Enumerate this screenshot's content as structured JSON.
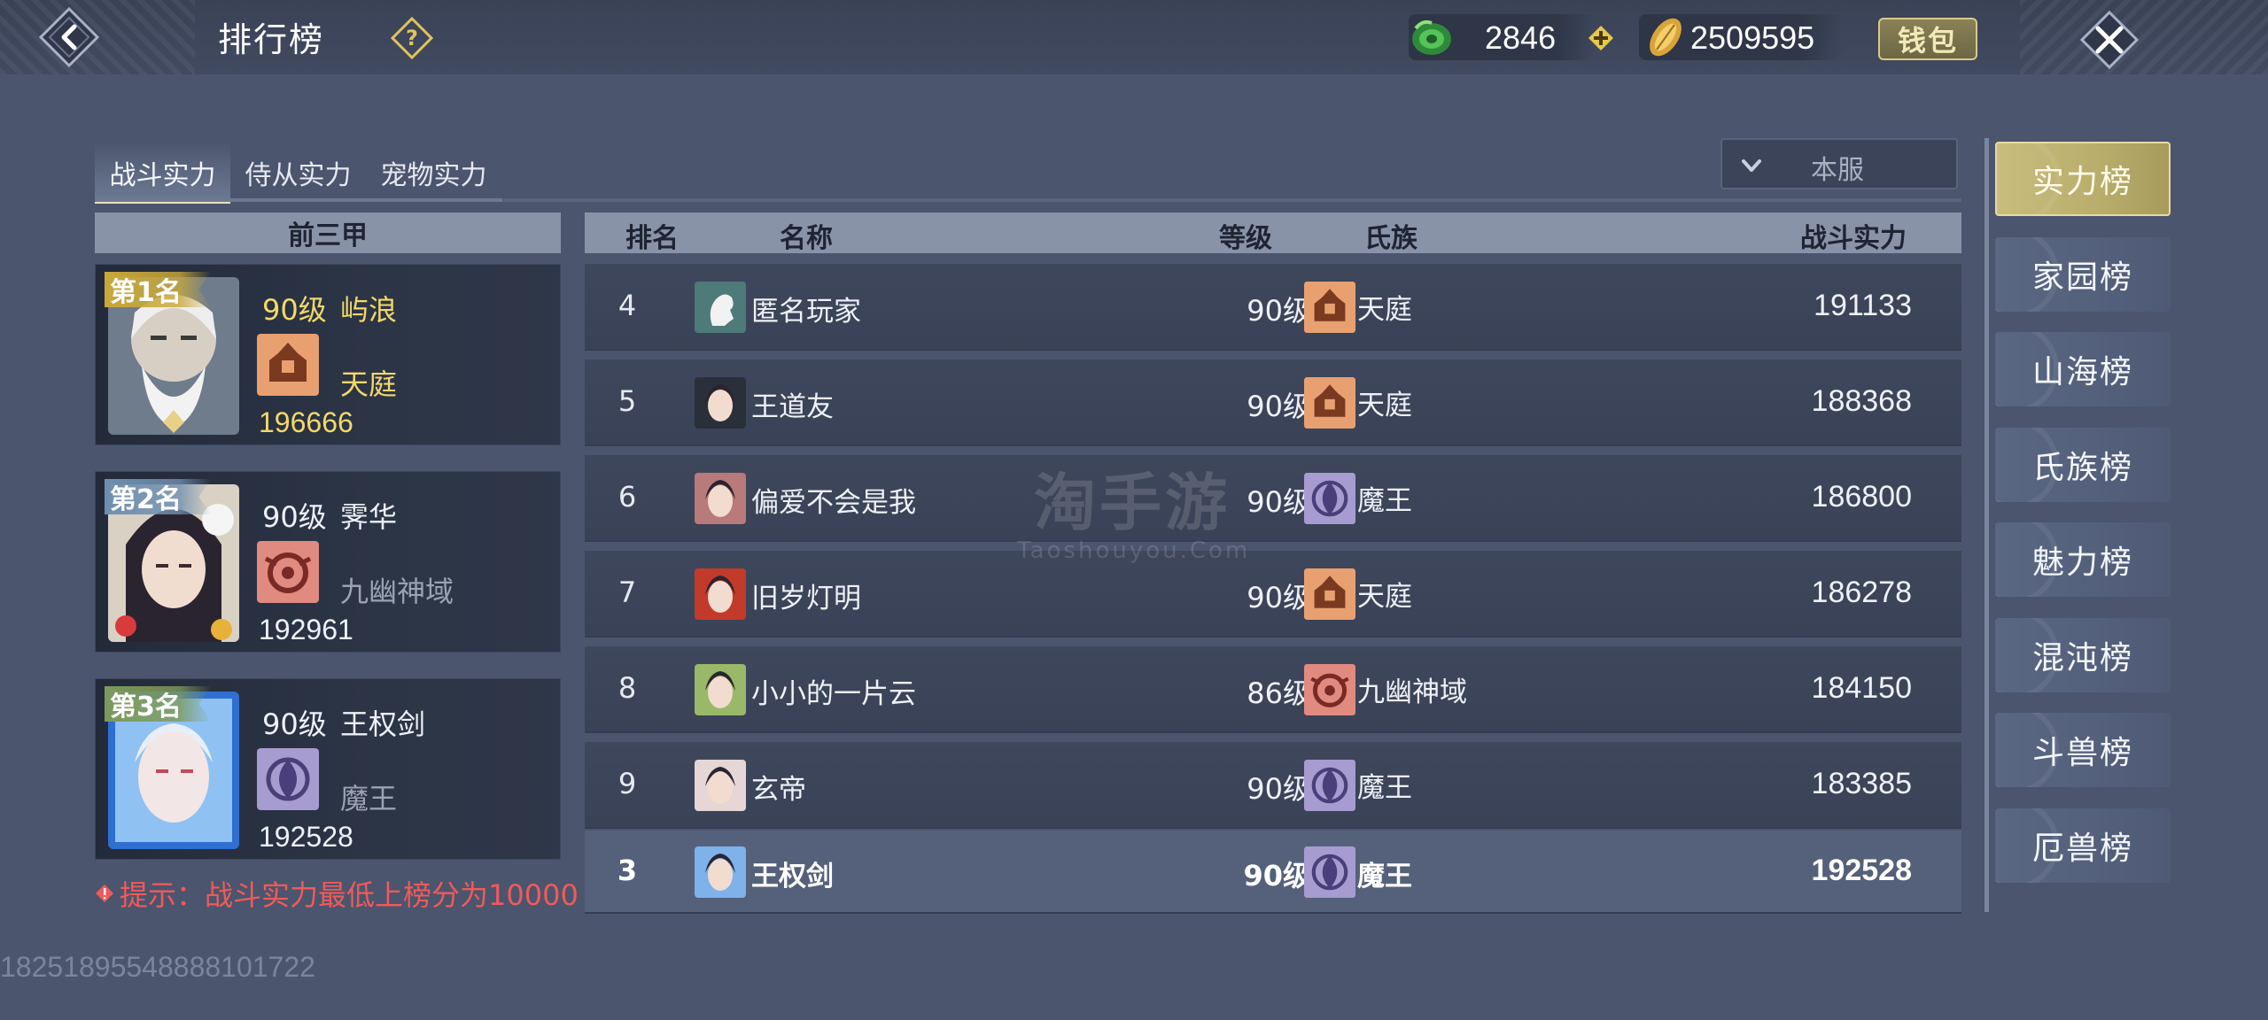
{
  "header": {
    "title": "排行榜",
    "jade_amount": "2846",
    "gold_amount": "2509595",
    "wallet_label": "钱包"
  },
  "tabs": [
    {
      "label": "战斗实力",
      "active": true
    },
    {
      "label": "侍从实力",
      "active": false
    },
    {
      "label": "宠物实力",
      "active": false
    }
  ],
  "server_filter": {
    "selected": "本服"
  },
  "top3": {
    "header": "前三甲",
    "entries": [
      {
        "rank_label": "第1名",
        "level": "90级",
        "name": "屿浪",
        "clan": "天庭",
        "power": "196666",
        "flag_color": "#c9a83a",
        "text_color": "#f3d96a"
      },
      {
        "rank_label": "第2名",
        "level": "90级",
        "name": "霁华",
        "clan": "九幽神域",
        "power": "192961",
        "flag_color": "#6f8fb0",
        "text_color": "#eef1f7"
      },
      {
        "rank_label": "第3名",
        "level": "90级",
        "name": "王权剑",
        "clan": "魔王",
        "power": "192528",
        "flag_color": "#7d9a5a",
        "text_color": "#eef1f7"
      }
    ]
  },
  "tip": "提示：战斗实力最低上榜分为10000",
  "table": {
    "headers": {
      "rank": "排名",
      "name": "名称",
      "level": "等级",
      "clan": "氏族",
      "power": "战斗实力"
    },
    "rows": [
      {
        "rank": "4",
        "name": "匿名玩家",
        "level": "90级",
        "clan": "天庭",
        "power": "191133",
        "avatar": "anonymous-avatar-icon",
        "clan_icon": "tianting-emblem-icon"
      },
      {
        "rank": "5",
        "name": "王道友",
        "level": "90级",
        "clan": "天庭",
        "power": "188368",
        "avatar": "player-avatar-icon",
        "clan_icon": "tianting-emblem-icon"
      },
      {
        "rank": "6",
        "name": "偏爱不会是我",
        "level": "90级",
        "clan": "魔王",
        "power": "186800",
        "avatar": "player-avatar-icon",
        "clan_icon": "mowang-emblem-icon"
      },
      {
        "rank": "7",
        "name": "旧岁灯明",
        "level": "90级",
        "clan": "天庭",
        "power": "186278",
        "avatar": "player-avatar-icon",
        "clan_icon": "tianting-emblem-icon"
      },
      {
        "rank": "8",
        "name": "小小的一片云",
        "level": "86级",
        "clan": "九幽神域",
        "power": "184150",
        "avatar": "player-avatar-icon",
        "clan_icon": "jiuyou-emblem-icon"
      },
      {
        "rank": "9",
        "name": "玄帝",
        "level": "90级",
        "clan": "魔王",
        "power": "183385",
        "avatar": "player-avatar-icon",
        "clan_icon": "mowang-emblem-icon"
      }
    ],
    "self_row": {
      "rank": "3",
      "name": "王权剑",
      "level": "90级",
      "clan": "魔王",
      "power": "192528",
      "avatar": "player-avatar-icon",
      "clan_icon": "mowang-emblem-icon"
    }
  },
  "categories": [
    {
      "label": "实力榜",
      "active": true
    },
    {
      "label": "家园榜",
      "active": false
    },
    {
      "label": "山海榜",
      "active": false
    },
    {
      "label": "氏族榜",
      "active": false
    },
    {
      "label": "魅力榜",
      "active": false
    },
    {
      "label": "混沌榜",
      "active": false
    },
    {
      "label": "斗兽榜",
      "active": false
    },
    {
      "label": "厄兽榜",
      "active": false
    }
  ],
  "watermark": {
    "title": "淘手游",
    "subtitle": "Taoshouyou.Com"
  },
  "footer_id": "18251895548888101722",
  "colors": {
    "tianting": "#e8a070",
    "mowang": "#a79cd0",
    "jiuyou": "#e08a80",
    "accent_gold": "#c9bd7e",
    "tip_red": "#f05a5a"
  }
}
